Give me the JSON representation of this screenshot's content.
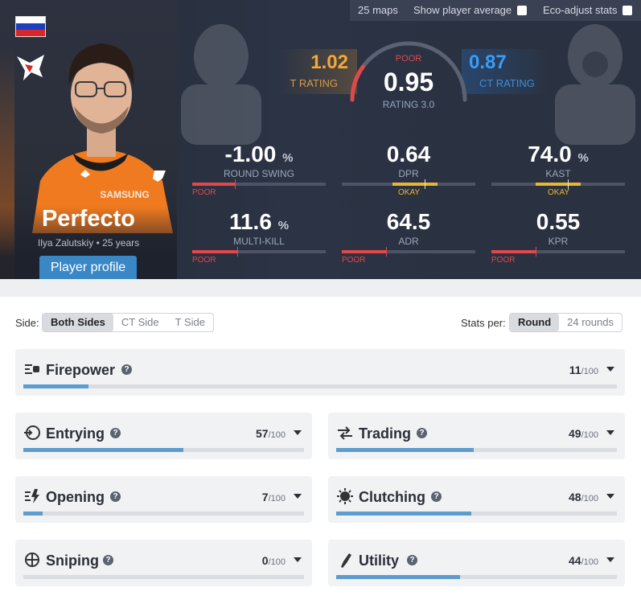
{
  "topbar": {
    "maps": "25 maps",
    "show_avg": "Show player average",
    "eco_adjust": "Eco-adjust stats"
  },
  "player": {
    "nickname": "Perfecto",
    "real_name": "Ilya Zalutskiy",
    "age": "25 years",
    "profile_button": "Player profile",
    "flag": "Russia",
    "jersey_text": "SAMSUNG"
  },
  "ratings": {
    "t_value": "1.02",
    "t_label": "T RATING",
    "main_verdict": "POOR",
    "main_value": "0.95",
    "main_label": "RATING 3.0",
    "ct_value": "0.87",
    "ct_label": "CT RATING"
  },
  "stats": [
    {
      "value": "-1.00",
      "unit": "%",
      "label": "ROUND SWING",
      "verdict": "POOR",
      "level": 0.32
    },
    {
      "value": "0.64",
      "unit": "",
      "label": "DPR",
      "verdict": "OKAY",
      "level": 0.55
    },
    {
      "value": "74.0",
      "unit": "%",
      "label": "KAST",
      "verdict": "OKAY",
      "level": 0.5
    },
    {
      "value": "11.6",
      "unit": "%",
      "label": "MULTI-KILL",
      "verdict": "POOR",
      "level": 0.34
    },
    {
      "value": "64.5",
      "unit": "",
      "label": "ADR",
      "verdict": "POOR",
      "level": 0.33
    },
    {
      "value": "0.55",
      "unit": "",
      "label": "KPR",
      "verdict": "POOR",
      "level": 0.33
    }
  ],
  "filters": {
    "side_label": "Side:",
    "sides": [
      "Both Sides",
      "CT Side",
      "T Side"
    ],
    "stats_per_label": "Stats per:",
    "per": [
      "Round",
      "24 rounds"
    ]
  },
  "categories": {
    "denominator": "/100",
    "firepower": {
      "title": "Firepower",
      "score": "11",
      "level": 0.11
    },
    "entrying": {
      "title": "Entrying",
      "score": "57",
      "level": 0.57
    },
    "trading": {
      "title": "Trading",
      "score": "49",
      "level": 0.49
    },
    "opening": {
      "title": "Opening",
      "score": "7",
      "level": 0.07
    },
    "clutching": {
      "title": "Clutching",
      "score": "48",
      "level": 0.48
    },
    "sniping": {
      "title": "Sniping",
      "score": "0",
      "level": 0.0
    },
    "utility": {
      "title": "Utility",
      "score": "44",
      "level": 0.44
    }
  },
  "colors": {
    "poor": "#e0484a",
    "okay": "#e8b630",
    "accent": "#3a87c6",
    "t_side": "#f2a83a",
    "ct_side": "#3a9cf5"
  },
  "icons": [
    "russia-flag-icon",
    "team-logo-icon",
    "help-icon",
    "chevron-down-icon",
    "firepower-icon",
    "entrying-icon",
    "trading-icon",
    "opening-icon",
    "clutching-icon",
    "sniping-icon",
    "utility-icon"
  ]
}
